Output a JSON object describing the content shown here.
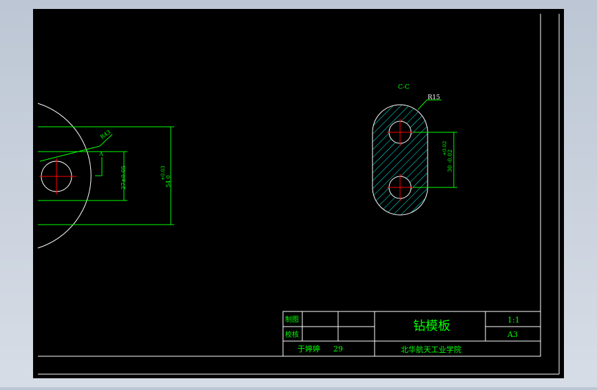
{
  "drawing": {
    "colors": {
      "paper": "#000000",
      "frame": "#ffffff",
      "dimension": "#00ff00",
      "centerline": "#ff0000",
      "hatch": "#00ffff",
      "outline": "#ffffff"
    },
    "left_view": {
      "radius_label": "R43",
      "section_mark": "A",
      "dim_small": "27±0.05",
      "dim_large_tol": "+0.03",
      "dim_large_base": "54 0"
    },
    "right_view": {
      "section_label": "C-C",
      "radius_label": "R15",
      "dim_label": "30 -0.02",
      "dim_tol": "+0.02"
    },
    "title_block": {
      "row1_label": "制图",
      "row2_label": "校核",
      "drawing_name": "钻模板",
      "scale": "1:1",
      "sheet_size": "A3",
      "student": "于婷婷",
      "number": "29",
      "school": "北华航天工业学院"
    }
  }
}
